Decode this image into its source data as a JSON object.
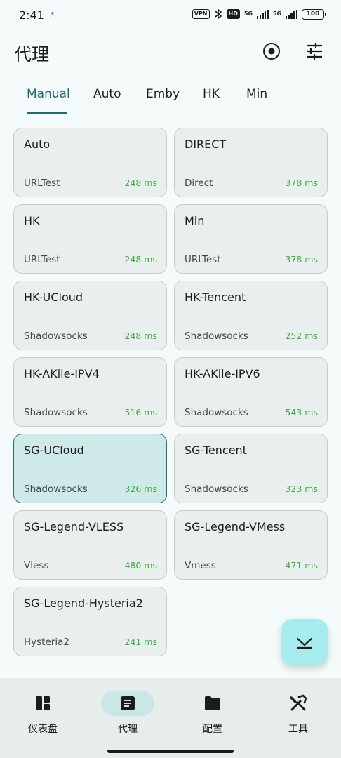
{
  "status_bar": {
    "time": "2:41",
    "vpn": "VPN",
    "hd": "HD",
    "net1": "5G",
    "net2": "5G",
    "battery": "100"
  },
  "header": {
    "title": "代理",
    "target_icon": "target-icon",
    "tune_icon": "tune-icon"
  },
  "tabs": [
    {
      "label": "Manual",
      "active": true
    },
    {
      "label": "Auto",
      "active": false
    },
    {
      "label": "Emby",
      "active": false
    },
    {
      "label": "HK",
      "active": false
    },
    {
      "label": "Min",
      "active": false
    }
  ],
  "proxies": [
    {
      "name": "Auto",
      "type": "URLTest",
      "delay": "248 ms"
    },
    {
      "name": "DIRECT",
      "type": "Direct",
      "delay": "378 ms"
    },
    {
      "name": "HK",
      "type": "URLTest",
      "delay": "248 ms"
    },
    {
      "name": "Min",
      "type": "URLTest",
      "delay": "378 ms"
    },
    {
      "name": "HK-UCloud",
      "type": "Shadowsocks",
      "delay": "248 ms"
    },
    {
      "name": "HK-Tencent",
      "type": "Shadowsocks",
      "delay": "252 ms"
    },
    {
      "name": "HK-AKile-IPV4",
      "type": "Shadowsocks",
      "delay": "516 ms"
    },
    {
      "name": "HK-AKile-IPV6",
      "type": "Shadowsocks",
      "delay": "543 ms"
    },
    {
      "name": "SG-UCloud",
      "type": "Shadowsocks",
      "delay": "326 ms",
      "selected": true
    },
    {
      "name": "SG-Tencent",
      "type": "Shadowsocks",
      "delay": "323 ms"
    },
    {
      "name": "SG-Legend-VLESS",
      "type": "Vless",
      "delay": "480 ms"
    },
    {
      "name": "SG-Legend-VMess",
      "type": "Vmess",
      "delay": "471 ms"
    },
    {
      "name": "SG-Legend-Hysteria2",
      "type": "Hysteria2",
      "delay": "241 ms"
    }
  ],
  "fab": {
    "icon": "scroll-to-selected-icon"
  },
  "bottom_nav": [
    {
      "label": "仪表盘",
      "icon": "dashboard-icon"
    },
    {
      "label": "代理",
      "icon": "proxy-list-icon",
      "active": true
    },
    {
      "label": "配置",
      "icon": "folder-icon"
    },
    {
      "label": "工具",
      "icon": "tools-icon"
    }
  ],
  "colors": {
    "accent": "#1f6a6a",
    "delay_green": "#3fae3f",
    "selected_card": "#cfe8e8",
    "fab": "#a6ecee"
  }
}
